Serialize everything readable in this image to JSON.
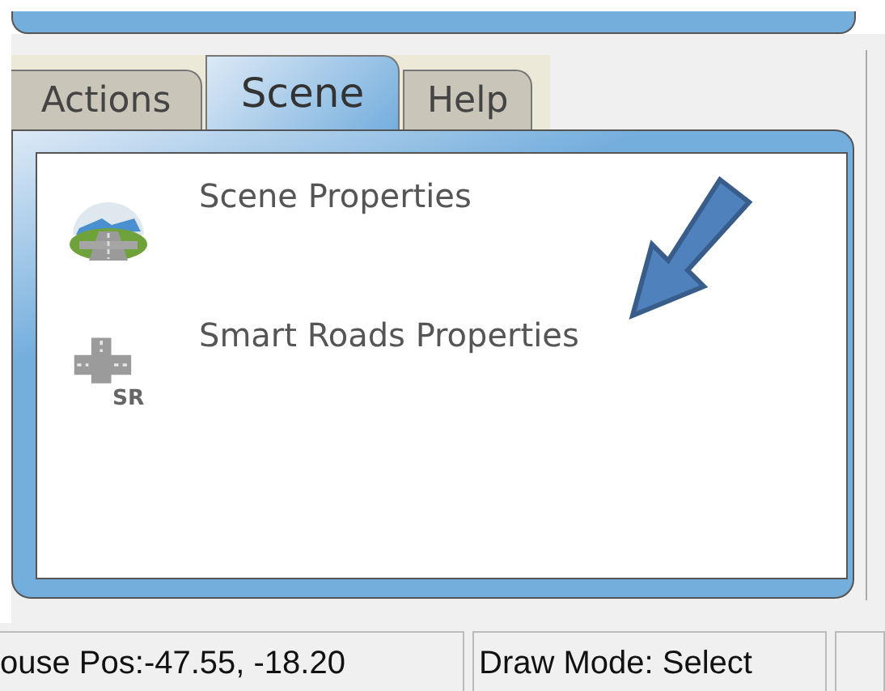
{
  "tabs": [
    {
      "label": "Actions",
      "selected": false
    },
    {
      "label": "Scene",
      "selected": true
    },
    {
      "label": "Help",
      "selected": false
    }
  ],
  "items": [
    {
      "kind": "scene",
      "label": "Scene Properties"
    },
    {
      "kind": "roads",
      "label": "Smart Roads Properties",
      "icon_text": "SR"
    }
  ],
  "status_bar": [
    "ouse Pos:-47.55, -18.20",
    "Draw Mode: Select"
  ]
}
